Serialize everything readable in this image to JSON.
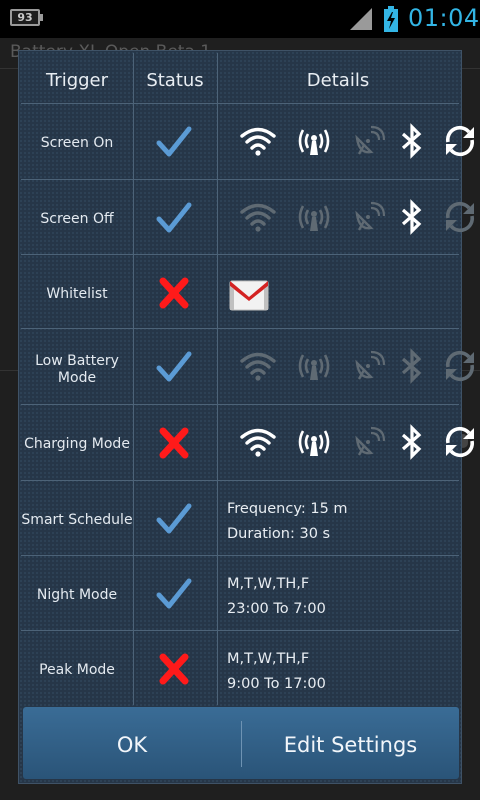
{
  "status_bar": {
    "battery_level": "93",
    "clock": "01:04",
    "icons": [
      "battery-badge-icon",
      "signal-icon",
      "battery-charging-icon"
    ],
    "accent": "#33b5e5"
  },
  "background_app": {
    "title": "Battery XL Open Beta 1"
  },
  "dialog": {
    "headers": {
      "trigger": "Trigger",
      "status": "Status",
      "details": "Details"
    },
    "rows": [
      {
        "trigger": "Screen On",
        "status": "enabled",
        "details_type": "icons",
        "icons": {
          "wifi": true,
          "data": true,
          "gps": false,
          "bluetooth": true,
          "sync": true
        }
      },
      {
        "trigger": "Screen Off",
        "status": "enabled",
        "details_type": "icons",
        "icons": {
          "wifi": false,
          "data": false,
          "gps": false,
          "bluetooth": true,
          "sync": false
        }
      },
      {
        "trigger": "Whitelist",
        "status": "disabled",
        "details_type": "app",
        "app_icon": "gmail-icon"
      },
      {
        "trigger": "Low Battery Mode",
        "trigger_lines": [
          "Low Battery",
          "Mode"
        ],
        "status": "enabled",
        "details_type": "icons",
        "icons": {
          "wifi": false,
          "data": false,
          "gps": false,
          "bluetooth": false,
          "sync": false
        }
      },
      {
        "trigger": "Charging Mode",
        "status": "disabled",
        "details_type": "icons",
        "icons": {
          "wifi": true,
          "data": true,
          "gps": false,
          "bluetooth": true,
          "sync": true
        }
      },
      {
        "trigger": "Smart Schedule",
        "status": "enabled",
        "details_type": "text",
        "lines": [
          "Frequency: 15 m",
          "Duration: 30 s"
        ]
      },
      {
        "trigger": "Night Mode",
        "status": "enabled",
        "details_type": "text",
        "lines": [
          "M,T,W,TH,F",
          "23:00 To 7:00"
        ]
      },
      {
        "trigger": "Peak Mode",
        "status": "disabled",
        "details_type": "text",
        "lines": [
          "M,T,W,TH,F",
          "9:00 To 17:00"
        ]
      }
    ],
    "buttons": {
      "ok": "OK",
      "edit_settings": "Edit Settings"
    },
    "colors": {
      "check": "#5b9bd5",
      "cross": "#ff1a1a",
      "icon_on": "#ffffff",
      "icon_off": "#5f6a73"
    }
  }
}
